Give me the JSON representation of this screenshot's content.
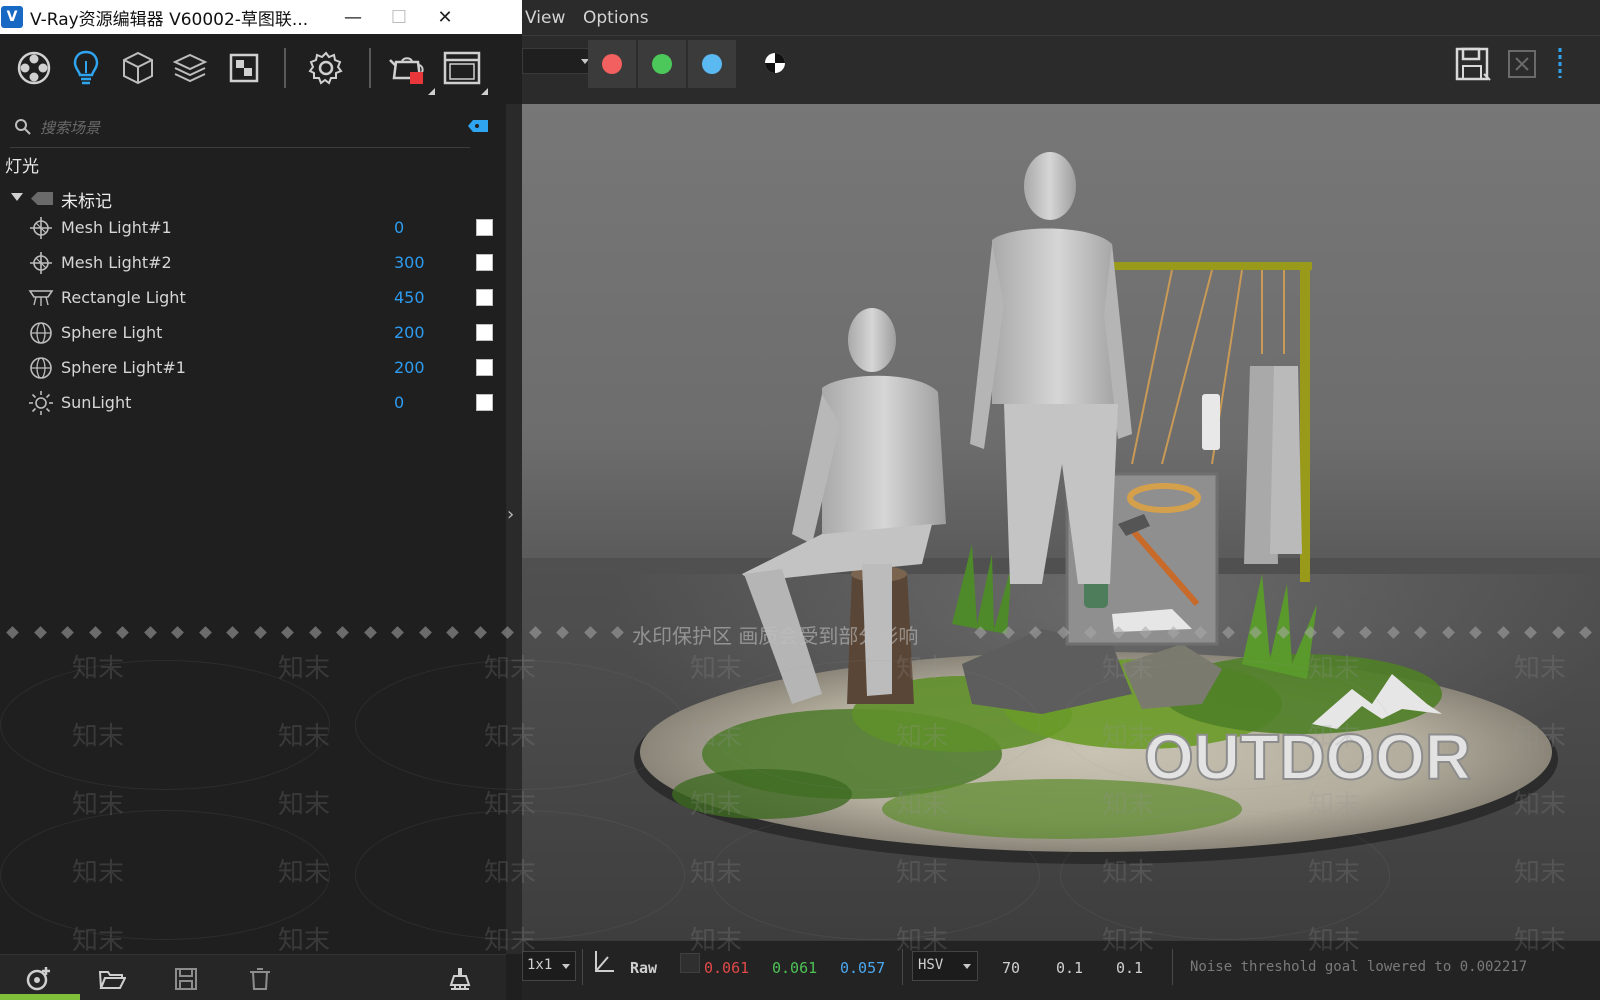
{
  "window": {
    "title": "V-Ray资源编辑器 V60002-草图联...",
    "app_logo": "V",
    "minimize": "—",
    "maximize": "☐",
    "close": "✕"
  },
  "toolbar": {
    "icons": [
      "materials-icon",
      "lights-icon",
      "geometry-icon",
      "render-elements-icon",
      "textures-icon",
      "settings-icon",
      "render-interactive-icon",
      "frame-buffer-icon"
    ],
    "active": "lights-icon"
  },
  "search": {
    "placeholder": "搜索场景"
  },
  "category": "灯光",
  "group": {
    "label": "未标记"
  },
  "lights": [
    {
      "name": "Mesh Light#1",
      "value": "0",
      "icon": "mesh-light-icon",
      "enabled": true
    },
    {
      "name": "Mesh Light#2",
      "value": "300",
      "icon": "mesh-light-icon",
      "enabled": true
    },
    {
      "name": "Rectangle Light",
      "value": "450",
      "icon": "rectangle-light-icon",
      "enabled": true
    },
    {
      "name": "Sphere Light",
      "value": "200",
      "icon": "sphere-light-icon",
      "enabled": true
    },
    {
      "name": "Sphere Light#1",
      "value": "200",
      "icon": "sphere-light-icon",
      "enabled": true
    },
    {
      "name": "SunLight",
      "value": "0",
      "icon": "sun-light-icon",
      "enabled": true
    }
  ],
  "bottom_bar": {
    "icons": [
      "add-asset-icon",
      "open-folder-icon",
      "save-icon",
      "delete-icon",
      "cleanup-icon"
    ]
  },
  "vfb": {
    "menu": [
      "View",
      "Options"
    ],
    "channel_buttons": [
      {
        "name": "red-channel",
        "color": "#f26060"
      },
      {
        "name": "green-channel",
        "color": "#4cc85a"
      },
      {
        "name": "blue-channel",
        "color": "#5ab9f0"
      }
    ],
    "render_scene_text": "OUTDOOR",
    "status": {
      "zoom": "1x1",
      "color_space": "Raw",
      "r": "0.061",
      "g": "0.061",
      "b": "0.057",
      "mode": "HSV",
      "h": "70",
      "s": "0.1",
      "v": "0.1",
      "message": "Noise threshold goal lowered to 0.002217"
    },
    "status_colors": {
      "r": "#e34848",
      "g": "#4dc255",
      "b": "#4aa8f0"
    }
  },
  "watermark": {
    "notice": "水印保护区  画质会受到部分影响",
    "brand": "知末"
  }
}
